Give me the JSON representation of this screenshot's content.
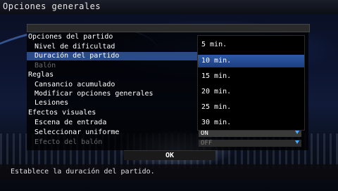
{
  "title": "Opciones generales",
  "sections": [
    {
      "label": "Opciones del partido"
    },
    {
      "label": "Reglas"
    },
    {
      "label": "Efectos visuales"
    }
  ],
  "items": {
    "nivel": "Nivel de dificultad",
    "duracion": "Duración del partido",
    "balon": "Balón",
    "cansancio": "Cansancio acumulado",
    "modificar": "Modificar opciones generales",
    "lesiones": "Lesiones",
    "escena": "Escena de entrada",
    "uniforme": "Seleccionar uniforme",
    "efecto_balon": "Efecto del balón"
  },
  "dropdown": {
    "options": [
      "5 min.",
      "10 min.",
      "15 min.",
      "20 min.",
      "25 min.",
      "30 min."
    ],
    "selected": "10 min."
  },
  "values": {
    "uniforme": "ON",
    "efecto_balon": "OFF"
  },
  "ok_label": "OK",
  "status": "Establece la duración del partido.",
  "colors": {
    "selection": "#2a4a88",
    "arrow": "#4aa8ff"
  }
}
